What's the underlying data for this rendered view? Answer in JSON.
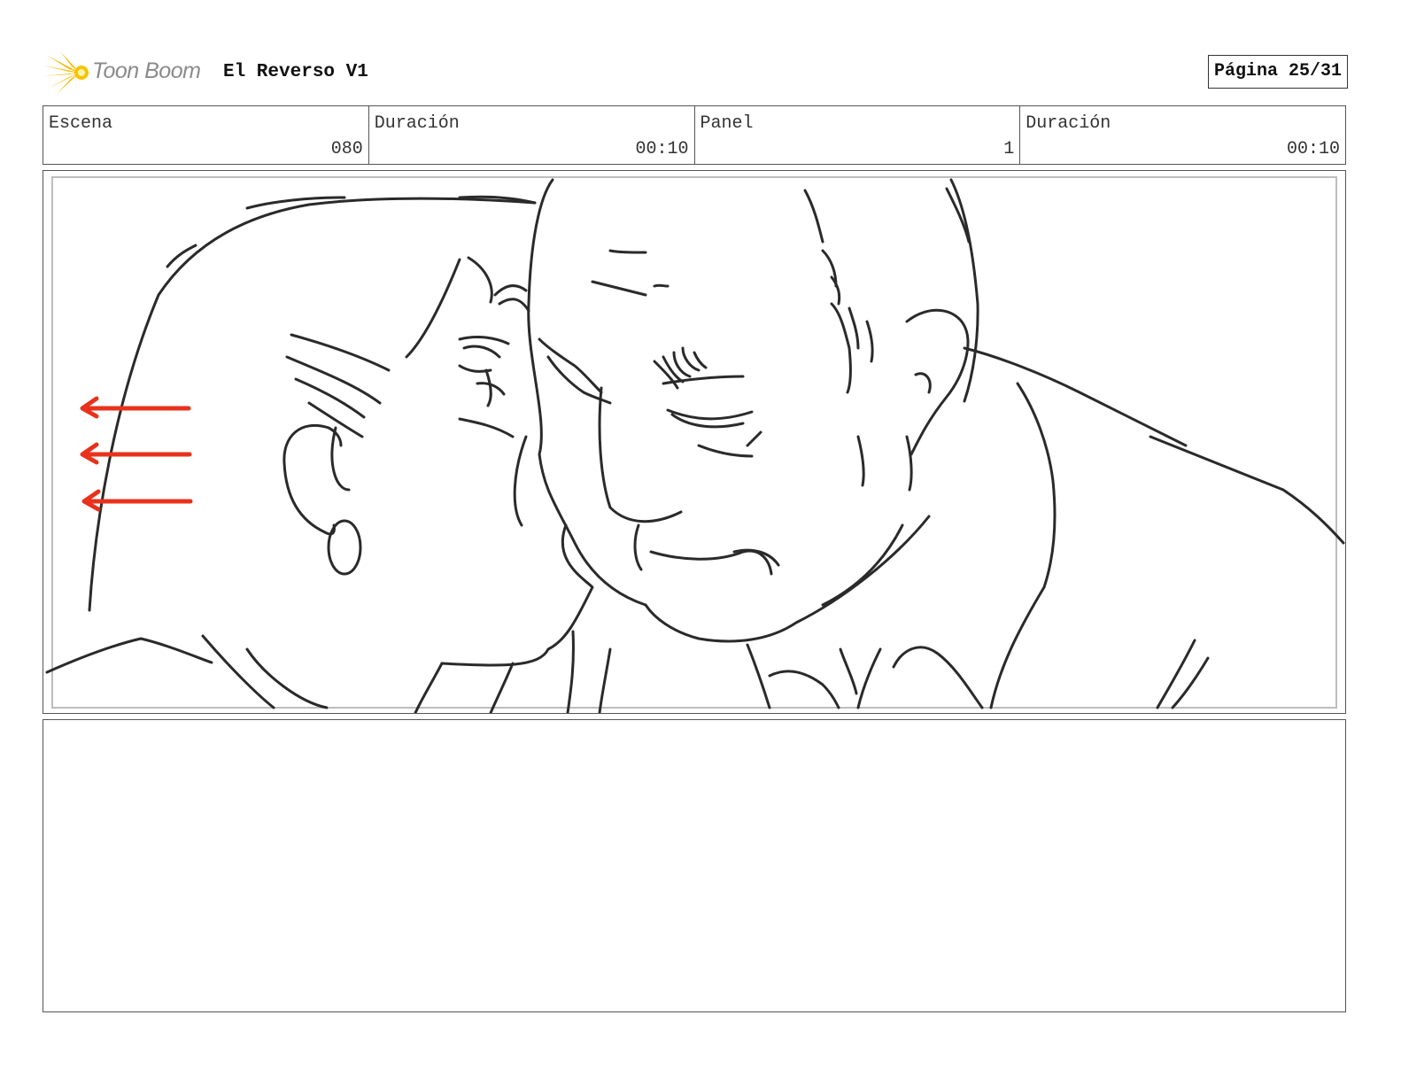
{
  "header": {
    "logo_text": "Toon Boom",
    "project_title": "El Reverso V1",
    "page_label": "Página 25/31"
  },
  "info": {
    "scene_label": "Escena",
    "scene_value": "080",
    "scene_duration_label": "Duración",
    "scene_duration_value": "00:10",
    "panel_label": "Panel",
    "panel_value": "1",
    "panel_duration_label": "Duración",
    "panel_duration_value": "00:10"
  },
  "colors": {
    "sketch_line": "#2a2a2a",
    "motion_arrow": "#e8321c",
    "logo_burst": "#f5b800"
  },
  "notes": {
    "dialogue": ""
  }
}
